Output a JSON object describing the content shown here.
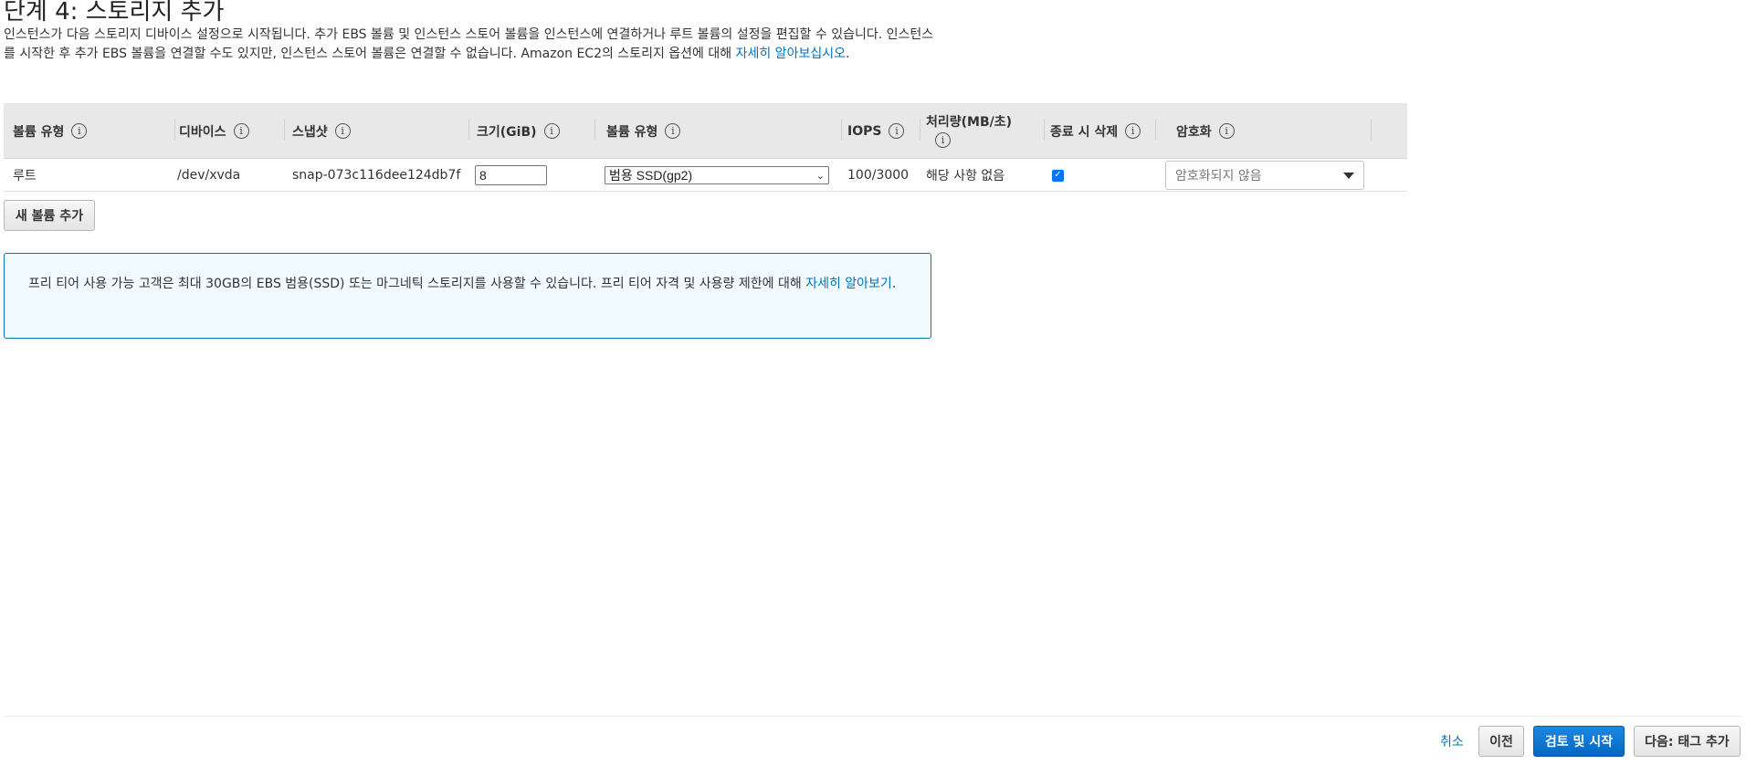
{
  "page": {
    "title": "단계 4: 스토리지 추가",
    "description_text": "인스턴스가 다음 스토리지 디바이스 설정으로 시작됩니다. 추가 EBS 볼륨 및 인스턴스 스토어 볼륨을 인스턴스에 연결하거나 루트 볼륨의 설정을 편집할 수 있습니다. 인스턴스를 시작한 후 추가 EBS 볼륨을 연결할 수도 있지만, 인스턴스 스토어 볼륨은 연결할 수 없습니다. Amazon EC2의 스토리지 옵션에 대해 ",
    "description_link": "자세히 알아보십시오",
    "description_end": "."
  },
  "table": {
    "headers": {
      "volume_type": "볼륨 유형",
      "device": "디바이스",
      "snapshot": "스냅샷",
      "size": "크기(GiB)",
      "ebs_volume_type": "볼륨 유형",
      "iops": "IOPS",
      "throughput": "처리량(MB/초)",
      "delete_on_termination": "종료 시 삭제",
      "encryption": "암호화"
    },
    "info_glyph": "i",
    "rows": [
      {
        "volume_type": "루트",
        "device": "/dev/xvda",
        "snapshot": "snap-073c116dee124db7f",
        "size": "8",
        "ebs_volume_type": "범용 SSD(gp2)",
        "iops": "100/3000",
        "throughput": "해당 사항 없음",
        "delete_on_termination": true,
        "encryption": "암호화되지 않음"
      }
    ]
  },
  "actions": {
    "add_volume": "새 볼륨 추가",
    "cancel": "취소",
    "previous": "이전",
    "review_and_launch": "검토 및 시작",
    "next": "다음: 태그 추가"
  },
  "notice": {
    "text": "프리 티어 사용 가능 고객은 최대 30GB의 EBS 범용(SSD) 또는 마그네틱 스토리지를 사용할 수 있습니다. 프리 티어 자격 및 사용량 제한에 대해 ",
    "link": "자세히 알아보기",
    "end": "."
  },
  "colors": {
    "link": "#0073bb",
    "primary_button": "#0972d3",
    "header_bg": "#e8e8e8",
    "notice_bg": "#f1faff",
    "notice_border": "#0073bb"
  },
  "icons": {
    "info": "info-circle-icon",
    "dropdown": "caret-down-icon",
    "select_chevron": "chevron-down-icon",
    "check": "checkmark-icon"
  }
}
